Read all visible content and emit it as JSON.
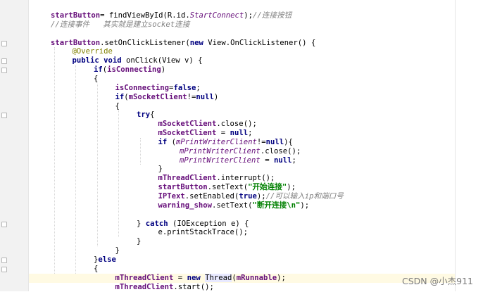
{
  "lines": [
    {
      "indent": 0,
      "tokens": [
        {
          "t": "startButton",
          "c": "fld"
        },
        {
          "t": "= findViewById(R.id.",
          "c": "plain"
        },
        {
          "t": "StartConnect",
          "c": "fldi"
        },
        {
          "t": ");",
          "c": "plain"
        },
        {
          "t": "//连接按钮",
          "c": "cmt"
        }
      ]
    },
    {
      "indent": 0,
      "tokens": [
        {
          "t": "//连接事件   其实就是建立socket连接",
          "c": "cmt"
        }
      ]
    },
    {
      "indent": 0,
      "tokens": []
    },
    {
      "indent": 0,
      "tokens": [
        {
          "t": "startButton",
          "c": "fld"
        },
        {
          "t": ".setOnClickListener(",
          "c": "plain"
        },
        {
          "t": "new ",
          "c": "kw"
        },
        {
          "t": "View.OnClickListener() {",
          "c": "plain"
        }
      ]
    },
    {
      "indent": 1,
      "tokens": [
        {
          "t": "@Override",
          "c": "ann"
        }
      ]
    },
    {
      "indent": 1,
      "tokens": [
        {
          "t": "public void ",
          "c": "kw"
        },
        {
          "t": "onClick(View v) {",
          "c": "plain"
        }
      ]
    },
    {
      "indent": 2,
      "tokens": [
        {
          "t": "if",
          "c": "kw"
        },
        {
          "t": "(",
          "c": "plain"
        },
        {
          "t": "isConnecting",
          "c": "fld"
        },
        {
          "t": ")",
          "c": "plain"
        }
      ]
    },
    {
      "indent": 2,
      "tokens": [
        {
          "t": "{",
          "c": "plain"
        }
      ]
    },
    {
      "indent": 3,
      "tokens": [
        {
          "t": "isConnecting",
          "c": "fld"
        },
        {
          "t": "=",
          "c": "plain"
        },
        {
          "t": "false",
          "c": "kw"
        },
        {
          "t": ";",
          "c": "plain"
        }
      ]
    },
    {
      "indent": 3,
      "tokens": [
        {
          "t": "if",
          "c": "kw"
        },
        {
          "t": "(",
          "c": "plain"
        },
        {
          "t": "mSocketClient",
          "c": "fld"
        },
        {
          "t": "!=",
          "c": "plain"
        },
        {
          "t": "null",
          "c": "kw"
        },
        {
          "t": ")",
          "c": "plain"
        }
      ]
    },
    {
      "indent": 3,
      "tokens": [
        {
          "t": "{",
          "c": "plain"
        }
      ]
    },
    {
      "indent": 4,
      "tokens": [
        {
          "t": "try",
          "c": "kw"
        },
        {
          "t": "{",
          "c": "plain"
        }
      ]
    },
    {
      "indent": 5,
      "tokens": [
        {
          "t": "mSocketClient",
          "c": "fld"
        },
        {
          "t": ".close();",
          "c": "plain"
        }
      ]
    },
    {
      "indent": 5,
      "tokens": [
        {
          "t": "mSocketClient",
          "c": "fld"
        },
        {
          "t": " = ",
          "c": "plain"
        },
        {
          "t": "null",
          "c": "kw"
        },
        {
          "t": ";",
          "c": "plain"
        }
      ]
    },
    {
      "indent": 5,
      "tokens": [
        {
          "t": "if ",
          "c": "kw"
        },
        {
          "t": "(",
          "c": "plain"
        },
        {
          "t": "mPrintWriterClient",
          "c": "fldi"
        },
        {
          "t": "!=",
          "c": "plain"
        },
        {
          "t": "null",
          "c": "kw"
        },
        {
          "t": "){",
          "c": "plain"
        }
      ]
    },
    {
      "indent": 6,
      "tokens": [
        {
          "t": "mPrintWriterClient",
          "c": "fldi"
        },
        {
          "t": ".close();",
          "c": "plain"
        }
      ]
    },
    {
      "indent": 6,
      "tokens": [
        {
          "t": "mPrintWriterClient",
          "c": "fldi"
        },
        {
          "t": " = ",
          "c": "plain"
        },
        {
          "t": "null",
          "c": "kw"
        },
        {
          "t": ";",
          "c": "plain"
        }
      ]
    },
    {
      "indent": 5,
      "tokens": [
        {
          "t": "}",
          "c": "plain"
        }
      ]
    },
    {
      "indent": 5,
      "tokens": [
        {
          "t": "mThreadClient",
          "c": "fld"
        },
        {
          "t": ".interrupt();",
          "c": "plain"
        }
      ]
    },
    {
      "indent": 5,
      "tokens": [
        {
          "t": "startButton",
          "c": "fld"
        },
        {
          "t": ".setText(",
          "c": "plain"
        },
        {
          "t": "\"开始连接\"",
          "c": "str"
        },
        {
          "t": ");",
          "c": "plain"
        }
      ]
    },
    {
      "indent": 5,
      "tokens": [
        {
          "t": "IPText",
          "c": "fld"
        },
        {
          "t": ".setEnabled(",
          "c": "plain"
        },
        {
          "t": "true",
          "c": "kw"
        },
        {
          "t": ");",
          "c": "plain"
        },
        {
          "t": "//可以输入ip和端口号",
          "c": "cmt"
        }
      ]
    },
    {
      "indent": 5,
      "tokens": [
        {
          "t": "warning_show",
          "c": "fld"
        },
        {
          "t": ".setText(",
          "c": "plain"
        },
        {
          "t": "\"断开连接\\n\"",
          "c": "str"
        },
        {
          "t": ");",
          "c": "plain"
        }
      ]
    },
    {
      "indent": 0,
      "tokens": []
    },
    {
      "indent": 4,
      "tokens": [
        {
          "t": "} ",
          "c": "plain"
        },
        {
          "t": "catch ",
          "c": "kw"
        },
        {
          "t": "(IOException e) {",
          "c": "plain"
        }
      ]
    },
    {
      "indent": 5,
      "tokens": [
        {
          "t": "e.printStackTrace();",
          "c": "plain"
        }
      ]
    },
    {
      "indent": 4,
      "tokens": [
        {
          "t": "}",
          "c": "plain"
        }
      ]
    },
    {
      "indent": 3,
      "tokens": [
        {
          "t": "}",
          "c": "plain"
        }
      ]
    },
    {
      "indent": 2,
      "tokens": [
        {
          "t": "}",
          "c": "plain"
        },
        {
          "t": "else",
          "c": "kw"
        }
      ]
    },
    {
      "indent": 2,
      "tokens": [
        {
          "t": "{",
          "c": "plain"
        }
      ]
    },
    {
      "indent": 3,
      "highlight": true,
      "tokens": [
        {
          "t": "mThreadClient",
          "c": "fld"
        },
        {
          "t": " = ",
          "c": "plain"
        },
        {
          "t": "new ",
          "c": "kw"
        },
        {
          "t": "Thread",
          "c": "thread-hl"
        },
        {
          "t": "(",
          "c": "plain"
        },
        {
          "t": "mRunnable",
          "c": "fld"
        },
        {
          "t": ");",
          "c": "plain"
        }
      ]
    },
    {
      "indent": 3,
      "tokens": [
        {
          "t": "mThreadClient",
          "c": "fld"
        },
        {
          "t": ".start();",
          "c": "plain"
        }
      ]
    }
  ],
  "fold_markers_rows": [
    3,
    5,
    6,
    11,
    23,
    27,
    28
  ],
  "watermark": "CSDN @小杰911"
}
